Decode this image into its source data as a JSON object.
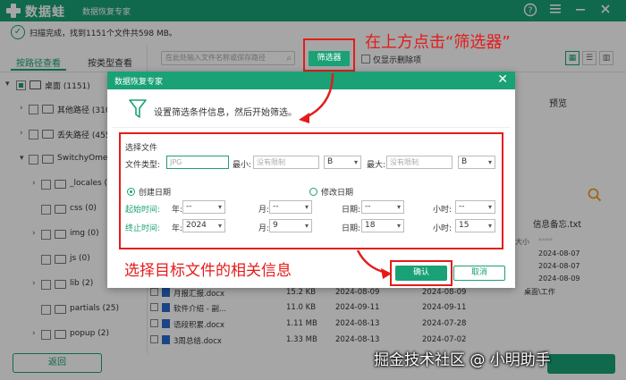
{
  "app": {
    "brand": "数据蛙",
    "subtitle": "数据恢复专家"
  },
  "status": {
    "text": "扫描完成，找到1151个文件共598 MB。"
  },
  "annotations": {
    "top": "在上方点击“筛选器”",
    "bottom": "选择目标文件的相关信息"
  },
  "tabs": [
    "按路径查看",
    "按类型查看"
  ],
  "tree": [
    {
      "label": "桌面 (1151)"
    },
    {
      "label": "其他路径 (310)"
    },
    {
      "label": "丢失路径 (455)"
    },
    {
      "label": "SwitchyOmega"
    },
    {
      "label": "_locales (6)"
    },
    {
      "label": "css (0)"
    },
    {
      "label": "img (0)"
    },
    {
      "label": "js (0)"
    },
    {
      "label": "lib (2)"
    },
    {
      "label": "partials (25)"
    },
    {
      "label": "popup (2)"
    }
  ],
  "toolbar": {
    "search_placeholder": "在此处输入文件名称或保存路径",
    "filter_label": "筛选器",
    "show_deleted": "仅显示删除项"
  },
  "files": [
    {
      "name": "月报汇报.docx",
      "size": "15.2 KB",
      "date1": "2024-08-09",
      "date2": "2024-08-09"
    },
    {
      "name": "软件介绍 - 副...",
      "size": "11.0 KB",
      "date1": "2024-09-11",
      "date2": "2024-09-11"
    },
    {
      "name": "语段积累.docx",
      "size": "1.11 MB",
      "date1": "2024-08-13",
      "date2": "2024-07-28"
    },
    {
      "name": "3周总结.docx",
      "size": "1.33 MB",
      "date1": "2024-08-13",
      "date2": "2024-07-02"
    }
  ],
  "preview": {
    "title": "预览",
    "filename": "信息备忘.txt",
    "meta": [
      {
        "k": "大小",
        "v": "****"
      },
      {
        "k": "",
        "v": "2024-08-07"
      },
      {
        "k": "",
        "v": "2024-08-07"
      },
      {
        "k": "",
        "v": "2024-08-09"
      },
      {
        "k": "",
        "v": "桌面\\工作"
      }
    ]
  },
  "bottom": {
    "back": "返回",
    "watermark": "掘金技术社区 @ 小明助手"
  },
  "modal": {
    "title": "数据恢复专家",
    "desc": "设置筛选条件信息，然后开始筛选。",
    "section": "选择文件",
    "type_label": "文件类型:",
    "type_placeholder": "JPG",
    "min_label": "最小:",
    "min_placeholder": "没有限制",
    "min_unit": "B",
    "max_label": "最大:",
    "max_placeholder": "没有限制",
    "max_unit": "B",
    "radio_create": "创建日期",
    "radio_modify": "修改日期",
    "start_label": "起始时间:",
    "end_label": "终止时间:",
    "year_label": "年:",
    "month_label": "月:",
    "day_label": "日期:",
    "hour_label": "小时:",
    "start": {
      "year": "--",
      "month": "--",
      "day": "--",
      "hour": "--"
    },
    "end": {
      "year": "2024",
      "month": "9",
      "day": "18",
      "hour": "15"
    },
    "ok": "确认",
    "cancel": "取消"
  },
  "colors": {
    "accent": "#1aa176",
    "annotation": "#e51b1b"
  }
}
